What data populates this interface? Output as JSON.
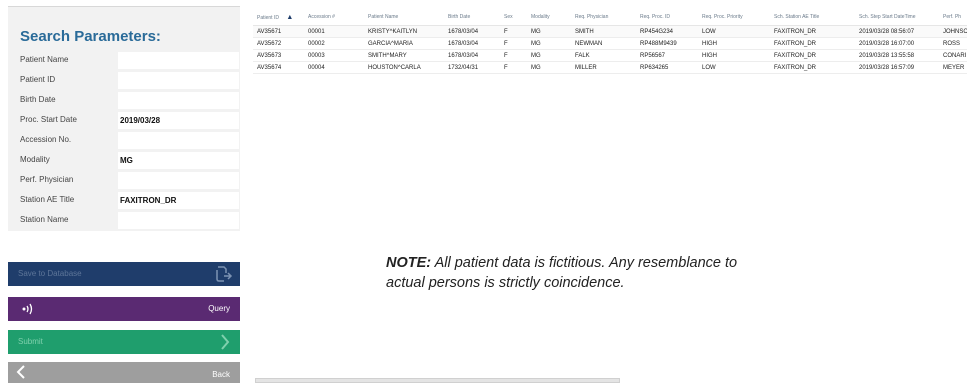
{
  "search": {
    "title": "Search Parameters:",
    "params": [
      {
        "label": "Patient Name",
        "value": ""
      },
      {
        "label": "Patient ID",
        "value": ""
      },
      {
        "label": "Birth Date",
        "value": ""
      },
      {
        "label": "Proc. Start Date",
        "value": "2019/03/28"
      },
      {
        "label": "Accession No.",
        "value": ""
      },
      {
        "label": "Modality",
        "value": "MG"
      },
      {
        "label": "Perf. Physician",
        "value": ""
      },
      {
        "label": "Station AE Title",
        "value": "FAXITRON_DR"
      },
      {
        "label": "Station Name",
        "value": ""
      }
    ]
  },
  "buttons": {
    "save_label": "Save to Database",
    "query_label": "Query",
    "submit_label": "Submit",
    "back_label": "Back"
  },
  "table": {
    "columns": [
      "Patient ID",
      "Accession #",
      "Patient Name",
      "Birth Date",
      "Sex",
      "Modality",
      "Req. Physician",
      "Req. Proc. ID",
      "Req. Proc. Priority",
      "Sch. Station AE Title",
      "Sch. Step Start DateTime",
      "Perf. Ph"
    ],
    "sort_indicator": "▲",
    "rows": [
      [
        "AV35671",
        "00001",
        "KRISTY^KAITLYN",
        "1678/03/04",
        "F",
        "MG",
        "SMITH",
        "RP454G234",
        "LOW",
        "FAXITRON_DR",
        "2019/03/28 08:56:07",
        "JOHNSC"
      ],
      [
        "AV35672",
        "00002",
        "GARCIA^MARIA",
        "1678/03/04",
        "F",
        "MG",
        "NEWMAN",
        "RP488M9439",
        "HIGH",
        "FAXITRON_DR",
        "2019/03/28 16:07:00",
        "ROSS"
      ],
      [
        "AV35673",
        "00003",
        "SMITH^MARY",
        "1678/03/04",
        "F",
        "MG",
        "FALK",
        "RP56567",
        "HIGH",
        "FAXITRON_DR",
        "2019/03/28 13:55:58",
        "CONARI"
      ],
      [
        "AV35674",
        "00004",
        "HOUSTON^CARLA",
        "1732/04/31",
        "F",
        "MG",
        "MILLER",
        "RP634265",
        "LOW",
        "FAXITRON_DR",
        "2019/03/28 16:57:09",
        "MEYER"
      ]
    ]
  },
  "note": {
    "prefix": "NOTE:",
    "text": " All patient data is fictitious. Any resemblance to actual persons is strictly coincidence."
  },
  "icons": {
    "save": "save-to-db-icon",
    "query": "sound-wave-icon",
    "submit": "chevron-right-icon",
    "back": "chevron-left-icon"
  },
  "colors": {
    "title": "#2a6b99",
    "save_bg": "#1f3d6b",
    "query_bg": "#5a2a72",
    "submit_bg": "#1f9e6d",
    "back_bg": "#9e9e9e"
  }
}
